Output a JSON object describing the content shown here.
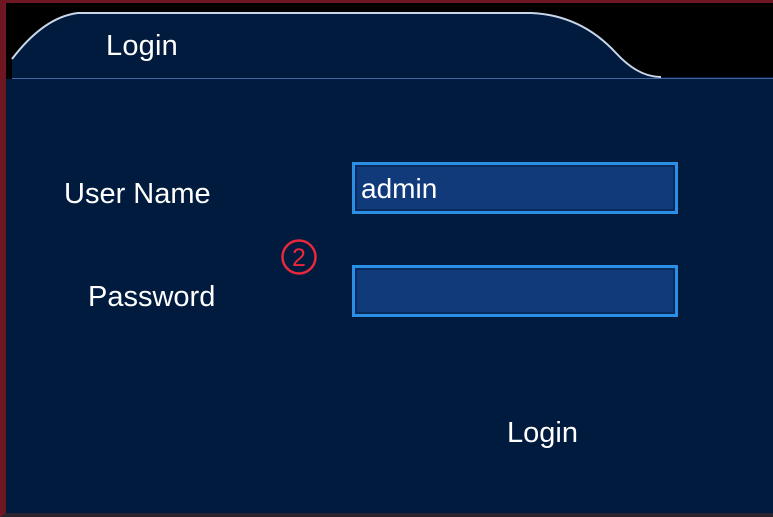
{
  "dialog": {
    "tab_title": "Login"
  },
  "form": {
    "username_label": "User Name",
    "username_value": "admin",
    "password_label": "Password",
    "password_value": ""
  },
  "annotation": {
    "step_marker": "2"
  },
  "actions": {
    "login_label": "Login"
  },
  "colors": {
    "panel_background": "#001b3e",
    "field_background": "#103a7a",
    "field_border": "#2b8fe6",
    "tab_underline": "#7fb3ff",
    "marker": "#e8283c"
  }
}
